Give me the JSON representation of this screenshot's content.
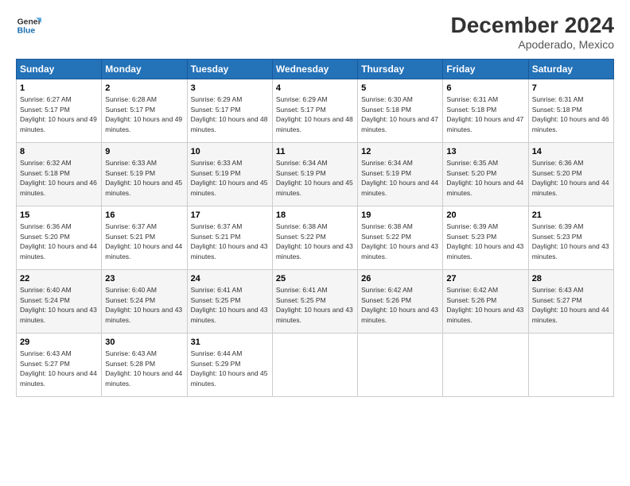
{
  "logo": {
    "line1": "General",
    "line2": "Blue"
  },
  "title": "December 2024",
  "subtitle": "Apoderado, Mexico",
  "weekdays": [
    "Sunday",
    "Monday",
    "Tuesday",
    "Wednesday",
    "Thursday",
    "Friday",
    "Saturday"
  ],
  "weeks": [
    [
      {
        "day": "1",
        "sunrise": "Sunrise: 6:27 AM",
        "sunset": "Sunset: 5:17 PM",
        "daylight": "Daylight: 10 hours and 49 minutes."
      },
      {
        "day": "2",
        "sunrise": "Sunrise: 6:28 AM",
        "sunset": "Sunset: 5:17 PM",
        "daylight": "Daylight: 10 hours and 49 minutes."
      },
      {
        "day": "3",
        "sunrise": "Sunrise: 6:29 AM",
        "sunset": "Sunset: 5:17 PM",
        "daylight": "Daylight: 10 hours and 48 minutes."
      },
      {
        "day": "4",
        "sunrise": "Sunrise: 6:29 AM",
        "sunset": "Sunset: 5:17 PM",
        "daylight": "Daylight: 10 hours and 48 minutes."
      },
      {
        "day": "5",
        "sunrise": "Sunrise: 6:30 AM",
        "sunset": "Sunset: 5:18 PM",
        "daylight": "Daylight: 10 hours and 47 minutes."
      },
      {
        "day": "6",
        "sunrise": "Sunrise: 6:31 AM",
        "sunset": "Sunset: 5:18 PM",
        "daylight": "Daylight: 10 hours and 47 minutes."
      },
      {
        "day": "7",
        "sunrise": "Sunrise: 6:31 AM",
        "sunset": "Sunset: 5:18 PM",
        "daylight": "Daylight: 10 hours and 46 minutes."
      }
    ],
    [
      {
        "day": "8",
        "sunrise": "Sunrise: 6:32 AM",
        "sunset": "Sunset: 5:18 PM",
        "daylight": "Daylight: 10 hours and 46 minutes."
      },
      {
        "day": "9",
        "sunrise": "Sunrise: 6:33 AM",
        "sunset": "Sunset: 5:19 PM",
        "daylight": "Daylight: 10 hours and 45 minutes."
      },
      {
        "day": "10",
        "sunrise": "Sunrise: 6:33 AM",
        "sunset": "Sunset: 5:19 PM",
        "daylight": "Daylight: 10 hours and 45 minutes."
      },
      {
        "day": "11",
        "sunrise": "Sunrise: 6:34 AM",
        "sunset": "Sunset: 5:19 PM",
        "daylight": "Daylight: 10 hours and 45 minutes."
      },
      {
        "day": "12",
        "sunrise": "Sunrise: 6:34 AM",
        "sunset": "Sunset: 5:19 PM",
        "daylight": "Daylight: 10 hours and 44 minutes."
      },
      {
        "day": "13",
        "sunrise": "Sunrise: 6:35 AM",
        "sunset": "Sunset: 5:20 PM",
        "daylight": "Daylight: 10 hours and 44 minutes."
      },
      {
        "day": "14",
        "sunrise": "Sunrise: 6:36 AM",
        "sunset": "Sunset: 5:20 PM",
        "daylight": "Daylight: 10 hours and 44 minutes."
      }
    ],
    [
      {
        "day": "15",
        "sunrise": "Sunrise: 6:36 AM",
        "sunset": "Sunset: 5:20 PM",
        "daylight": "Daylight: 10 hours and 44 minutes."
      },
      {
        "day": "16",
        "sunrise": "Sunrise: 6:37 AM",
        "sunset": "Sunset: 5:21 PM",
        "daylight": "Daylight: 10 hours and 44 minutes."
      },
      {
        "day": "17",
        "sunrise": "Sunrise: 6:37 AM",
        "sunset": "Sunset: 5:21 PM",
        "daylight": "Daylight: 10 hours and 43 minutes."
      },
      {
        "day": "18",
        "sunrise": "Sunrise: 6:38 AM",
        "sunset": "Sunset: 5:22 PM",
        "daylight": "Daylight: 10 hours and 43 minutes."
      },
      {
        "day": "19",
        "sunrise": "Sunrise: 6:38 AM",
        "sunset": "Sunset: 5:22 PM",
        "daylight": "Daylight: 10 hours and 43 minutes."
      },
      {
        "day": "20",
        "sunrise": "Sunrise: 6:39 AM",
        "sunset": "Sunset: 5:23 PM",
        "daylight": "Daylight: 10 hours and 43 minutes."
      },
      {
        "day": "21",
        "sunrise": "Sunrise: 6:39 AM",
        "sunset": "Sunset: 5:23 PM",
        "daylight": "Daylight: 10 hours and 43 minutes."
      }
    ],
    [
      {
        "day": "22",
        "sunrise": "Sunrise: 6:40 AM",
        "sunset": "Sunset: 5:24 PM",
        "daylight": "Daylight: 10 hours and 43 minutes."
      },
      {
        "day": "23",
        "sunrise": "Sunrise: 6:40 AM",
        "sunset": "Sunset: 5:24 PM",
        "daylight": "Daylight: 10 hours and 43 minutes."
      },
      {
        "day": "24",
        "sunrise": "Sunrise: 6:41 AM",
        "sunset": "Sunset: 5:25 PM",
        "daylight": "Daylight: 10 hours and 43 minutes."
      },
      {
        "day": "25",
        "sunrise": "Sunrise: 6:41 AM",
        "sunset": "Sunset: 5:25 PM",
        "daylight": "Daylight: 10 hours and 43 minutes."
      },
      {
        "day": "26",
        "sunrise": "Sunrise: 6:42 AM",
        "sunset": "Sunset: 5:26 PM",
        "daylight": "Daylight: 10 hours and 43 minutes."
      },
      {
        "day": "27",
        "sunrise": "Sunrise: 6:42 AM",
        "sunset": "Sunset: 5:26 PM",
        "daylight": "Daylight: 10 hours and 43 minutes."
      },
      {
        "day": "28",
        "sunrise": "Sunrise: 6:43 AM",
        "sunset": "Sunset: 5:27 PM",
        "daylight": "Daylight: 10 hours and 44 minutes."
      }
    ],
    [
      {
        "day": "29",
        "sunrise": "Sunrise: 6:43 AM",
        "sunset": "Sunset: 5:27 PM",
        "daylight": "Daylight: 10 hours and 44 minutes."
      },
      {
        "day": "30",
        "sunrise": "Sunrise: 6:43 AM",
        "sunset": "Sunset: 5:28 PM",
        "daylight": "Daylight: 10 hours and 44 minutes."
      },
      {
        "day": "31",
        "sunrise": "Sunrise: 6:44 AM",
        "sunset": "Sunset: 5:29 PM",
        "daylight": "Daylight: 10 hours and 45 minutes."
      },
      null,
      null,
      null,
      null
    ]
  ]
}
